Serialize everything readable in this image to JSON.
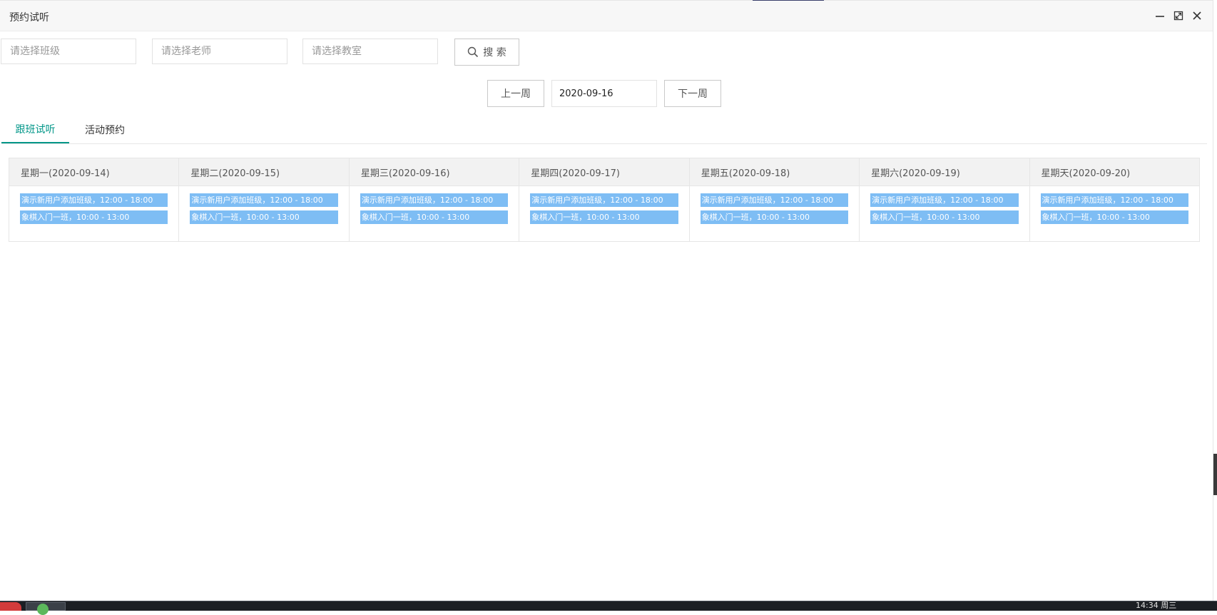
{
  "window": {
    "title": "预约试听"
  },
  "filters": {
    "class_placeholder": "请选择班级",
    "teacher_placeholder": "请选择老师",
    "classroom_placeholder": "请选择教室",
    "search_label": "搜 索"
  },
  "week_nav": {
    "prev_label": "上一周",
    "date_value": "2020-09-16",
    "next_label": "下一周"
  },
  "tabs": [
    {
      "label": "跟班试听",
      "active": true
    },
    {
      "label": "活动预约",
      "active": false
    }
  ],
  "calendar": {
    "days": [
      {
        "header": "星期一(2020-09-14)",
        "events": [
          "演示新用户添加班级，12:00 - 18:00",
          "象棋入门一班，10:00 - 13:00"
        ]
      },
      {
        "header": "星期二(2020-09-15)",
        "events": [
          "演示新用户添加班级，12:00 - 18:00",
          "象棋入门一班，10:00 - 13:00"
        ]
      },
      {
        "header": "星期三(2020-09-16)",
        "events": [
          "演示新用户添加班级，12:00 - 18:00",
          "象棋入门一班，10:00 - 13:00"
        ]
      },
      {
        "header": "星期四(2020-09-17)",
        "events": [
          "演示新用户添加班级，12:00 - 18:00",
          "象棋入门一班，10:00 - 13:00"
        ]
      },
      {
        "header": "星期五(2020-09-18)",
        "events": [
          "演示新用户添加班级，12:00 - 18:00",
          "象棋入门一班，10:00 - 13:00"
        ]
      },
      {
        "header": "星期六(2020-09-19)",
        "events": [
          "演示新用户添加班级，12:00 - 18:00",
          "象棋入门一班，10:00 - 13:00"
        ]
      },
      {
        "header": "星期天(2020-09-20)",
        "events": [
          "演示新用户添加班级，12:00 - 18:00",
          "象棋入门一班，10:00 - 13:00"
        ]
      }
    ]
  },
  "colors": {
    "accent": "#009688",
    "event_bg": "#7ebdf4",
    "header_bg": "#f2f2f2"
  },
  "icons": {
    "minimize": "minimize-icon",
    "maximize": "maximize-icon",
    "close": "close-icon",
    "search": "search-icon"
  },
  "taskbar": {
    "clock": "14:34 周三"
  }
}
